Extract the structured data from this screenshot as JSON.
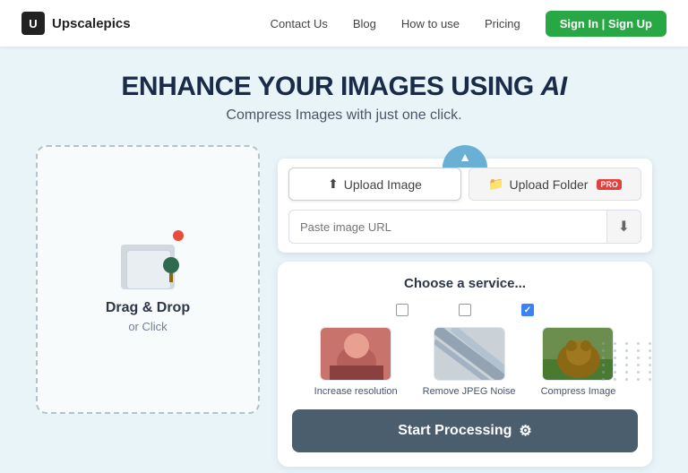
{
  "app": {
    "logo_letter": "U",
    "logo_name": "Upscalepics"
  },
  "nav": {
    "links": [
      {
        "id": "contact",
        "label": "Contact Us"
      },
      {
        "id": "blog",
        "label": "Blog"
      },
      {
        "id": "how-to-use",
        "label": "How to use"
      },
      {
        "id": "pricing",
        "label": "Pricing"
      }
    ],
    "cta_label": "Sign In | Sign Up"
  },
  "hero": {
    "title_prefix": "ENHANCE YOUR IMAGES USING ",
    "title_ai": "AI",
    "subtitle": "Compress Images with just one click."
  },
  "dropzone": {
    "label": "Drag & Drop",
    "sublabel": "or Click"
  },
  "upload_tabs": {
    "tab1_label": "Upload Image",
    "tab1_icon": "⬆",
    "tab2_label": "Upload Folder",
    "tab2_icon": "📁",
    "pro_badge": "PRO",
    "url_placeholder": "Paste image URL",
    "url_download_icon": "⬇"
  },
  "service": {
    "title": "Choose a service...",
    "items": [
      {
        "id": "resolution",
        "label": "Increase resolution",
        "checked": false
      },
      {
        "id": "noise",
        "label": "Remove JPEG Noise",
        "checked": false
      },
      {
        "id": "compress",
        "label": "Compress Image",
        "checked": true
      }
    ]
  },
  "cta": {
    "start_label": "Start Processing",
    "gear_icon": "⚙"
  }
}
